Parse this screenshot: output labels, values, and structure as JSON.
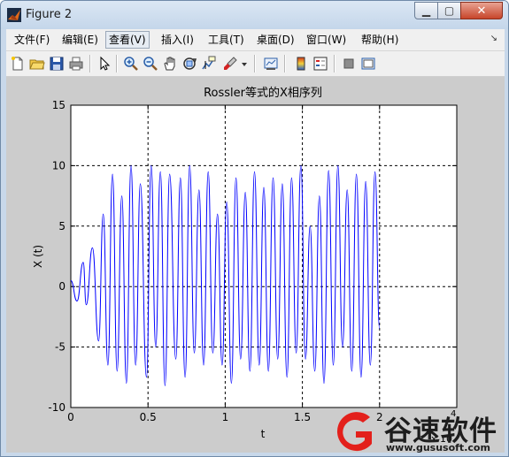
{
  "window": {
    "title": "Figure 2",
    "min_glyph": "▁",
    "max_glyph": "▢",
    "close_glyph": "✕"
  },
  "menu": {
    "items": [
      "文件(F)",
      "编辑(E)",
      "查看(V)",
      "插入(I)",
      "工具(T)",
      "桌面(D)",
      "窗口(W)",
      "帮助(H)"
    ],
    "active_index": 2,
    "overflow_glyph": "↘"
  },
  "toolbar": {
    "icons": [
      "new-figure-icon",
      "open-file-icon",
      "save-icon",
      "print-icon",
      "pointer-icon",
      "zoom-in-icon",
      "zoom-out-icon",
      "pan-icon",
      "rotate-3d-icon",
      "data-cursor-icon",
      "brush-icon",
      "link-icon",
      "colorbar-icon",
      "legend-icon",
      "hide-plot-tools-icon",
      "show-plot-tools-icon"
    ]
  },
  "chart_data": {
    "type": "line",
    "title": "Rossler等式的X相序列",
    "xlabel": "t",
    "ylabel": "X (t)",
    "x_exponent_label": "x 10",
    "x_exponent_power": "4",
    "xlim": [
      0,
      2.5
    ],
    "ylim": [
      -10,
      15
    ],
    "xticks": [
      0,
      0.5,
      1,
      1.5,
      2
    ],
    "xtick_labels": [
      "0",
      "0.5",
      "1",
      "1.5",
      "2"
    ],
    "yticks": [
      -10,
      -5,
      0,
      5,
      10,
      15
    ],
    "ytick_labels": [
      "-10",
      "-5",
      "0",
      "5",
      "10",
      "15"
    ],
    "grid": true,
    "grid_style": "dashed",
    "line_color": "#0000ff",
    "series": [
      {
        "x": [
          0,
          0.04,
          0.08,
          0.1,
          0.14,
          0.18,
          0.21,
          0.24,
          0.27,
          0.3,
          0.33,
          0.36,
          0.39,
          0.42,
          0.45,
          0.49,
          0.52,
          0.55,
          0.58,
          0.61,
          0.64,
          0.68,
          0.71,
          0.74,
          0.77,
          0.8,
          0.83,
          0.86,
          0.89,
          0.92,
          0.95,
          0.98,
          1.01,
          1.04,
          1.07,
          1.1,
          1.13,
          1.16,
          1.19,
          1.22,
          1.25,
          1.28,
          1.31,
          1.34,
          1.37,
          1.4,
          1.43,
          1.46,
          1.49,
          1.52,
          1.55,
          1.58,
          1.61,
          1.64,
          1.67,
          1.7,
          1.73,
          1.76,
          1.79,
          1.82,
          1.85,
          1.88,
          1.91,
          1.94,
          1.97,
          2.0
        ],
        "y": [
          0.5,
          -1.2,
          2,
          -1.5,
          3.2,
          -4.5,
          6,
          -6.5,
          9.3,
          -7,
          7.5,
          -8,
          10,
          -6.5,
          8.5,
          -7.5,
          10,
          -5,
          9.5,
          -8.2,
          9.3,
          -6,
          9,
          -7.5,
          10,
          -5.5,
          8,
          -6.5,
          9.5,
          -5.5,
          6,
          -6.5,
          7,
          -8,
          9,
          -6,
          7.8,
          -7,
          9.5,
          -6.5,
          8.2,
          -7,
          9,
          -6,
          8.5,
          -7.5,
          9,
          -5.5,
          10,
          -6,
          5,
          -7,
          7.5,
          -8,
          9.6,
          -6.5,
          10,
          -5,
          8,
          -7,
          9.3,
          -7.5,
          8.7,
          -6.5,
          9.5,
          -3.5
        ]
      }
    ]
  },
  "watermark": {
    "title": "谷速软件",
    "url": "www.gususoft.com"
  }
}
